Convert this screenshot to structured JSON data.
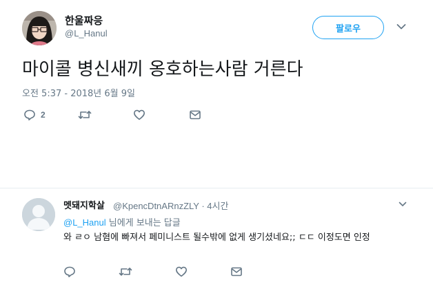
{
  "tweet": {
    "display_name": "한울짜응",
    "username": "@L_Hanul",
    "follow_label": "팔로우",
    "text": "마이콜 병신새끼 옹호하는사람 거른다",
    "timestamp": "오전 5:37 - 2018년 6월 9일",
    "reply_count": "2"
  },
  "reply": {
    "display_name": "멧돼지학살",
    "handle_time": "@KpencDtnARnzZLY · 4시간",
    "replying_to_user": "@L_Hanul",
    "replying_to_suffix": " 님에게 보내는 답글",
    "text": "와 ㄹㅇ 남혐에 빠져서 페미니스트 될수밖에 없게 생기셨네요;; ㄷㄷ 이정도면 인정"
  },
  "icons": [
    "reply-icon",
    "retweet-icon",
    "like-icon",
    "dm-icon",
    "caret-down-icon"
  ],
  "colors": {
    "accent": "#1da1f2",
    "muted": "#657786",
    "text": "#14171a"
  }
}
